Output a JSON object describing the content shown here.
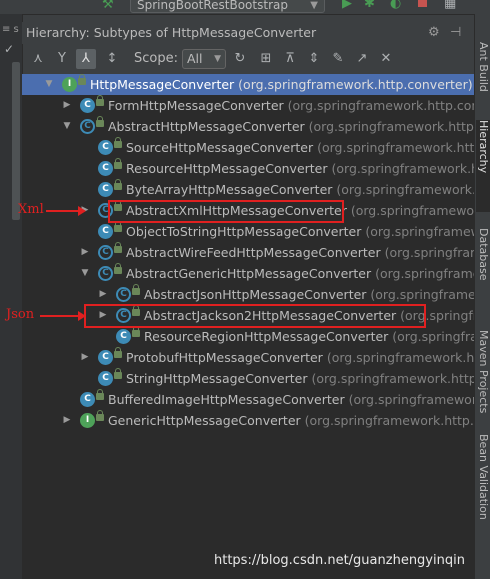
{
  "run_config": {
    "label": "SpringBootRestBootstrap"
  },
  "left_gutter": {
    "label": "≡ s"
  },
  "header": {
    "title": "Hierarchy:  Subtypes of HttpMessageConverter"
  },
  "toolbar": {
    "scope_label": "Scope:",
    "scope_value": "All"
  },
  "tree": [
    {
      "name": "HttpMessageConverter",
      "pkg": "(org.springframework.http.converter)",
      "depth": 0,
      "arrow": "down",
      "icon": "interface",
      "selected": true
    },
    {
      "name": "FormHttpMessageConverter",
      "pkg": "(org.springframework.http.converter)",
      "depth": 1,
      "arrow": "right",
      "icon": "class"
    },
    {
      "name": "AbstractHttpMessageConverter",
      "pkg": "(org.springframework.http.converter)",
      "depth": 1,
      "arrow": "down",
      "icon": "abstract"
    },
    {
      "name": "SourceHttpMessageConverter",
      "pkg": "(org.springframework.http.converter.x",
      "depth": 2,
      "arrow": "",
      "icon": "class"
    },
    {
      "name": "ResourceHttpMessageConverter",
      "pkg": "(org.springframework.http.co",
      "depth": 2,
      "arrow": "",
      "icon": "class"
    },
    {
      "name": "ByteArrayHttpMessageConverter",
      "pkg": "(org.springframework.http.co",
      "depth": 2,
      "arrow": "",
      "icon": "class"
    },
    {
      "name": "AbstractXmlHttpMessageConverter",
      "pkg": "(org.springframework.http",
      "depth": 2,
      "arrow": "right",
      "icon": "abstract"
    },
    {
      "name": "ObjectToStringHttpMessageConverter",
      "pkg": "(org.springframework.http.",
      "depth": 2,
      "arrow": "",
      "icon": "class"
    },
    {
      "name": "AbstractWireFeedHttpMessageConverter",
      "pkg": "(org.springframework.http",
      "depth": 2,
      "arrow": "right",
      "icon": "abstract"
    },
    {
      "name": "AbstractGenericHttpMessageConverter",
      "pkg": "(org.springframework.http",
      "depth": 2,
      "arrow": "down",
      "icon": "abstract"
    },
    {
      "name": "AbstractJsonHttpMessageConverter",
      "pkg": "(org.springframework.http",
      "depth": 3,
      "arrow": "right",
      "icon": "abstract"
    },
    {
      "name": "AbstractJackson2HttpMessageConverter",
      "pkg": "(org.springframew",
      "depth": 3,
      "arrow": "right",
      "icon": "abstract"
    },
    {
      "name": "ResourceRegionHttpMessageConverter",
      "pkg": "(org.springframework.h",
      "depth": 3,
      "arrow": "",
      "icon": "class"
    },
    {
      "name": "ProtobufHttpMessageConverter",
      "pkg": "(org.springframework.http.co",
      "depth": 2,
      "arrow": "right",
      "icon": "class"
    },
    {
      "name": "StringHttpMessageConverter",
      "pkg": "(org.springframework.http.conve",
      "depth": 2,
      "arrow": "",
      "icon": "class"
    },
    {
      "name": "BufferedImageHttpMessageConverter",
      "pkg": "(org.springframework.http.con",
      "depth": 1,
      "arrow": "",
      "icon": "class"
    },
    {
      "name": "GenericHttpMessageConverter",
      "pkg": "(org.springframework.http.converter)",
      "depth": 1,
      "arrow": "right",
      "icon": "interface"
    }
  ],
  "annotations": [
    {
      "label": "Xml"
    },
    {
      "label": "Json"
    }
  ],
  "right_tabs": [
    "Ant Build",
    "Hierarchy",
    "Database",
    "Maven Projects",
    "Bean Validation"
  ],
  "watermark": "https://blog.csdn.net/guanzhengyinqin"
}
